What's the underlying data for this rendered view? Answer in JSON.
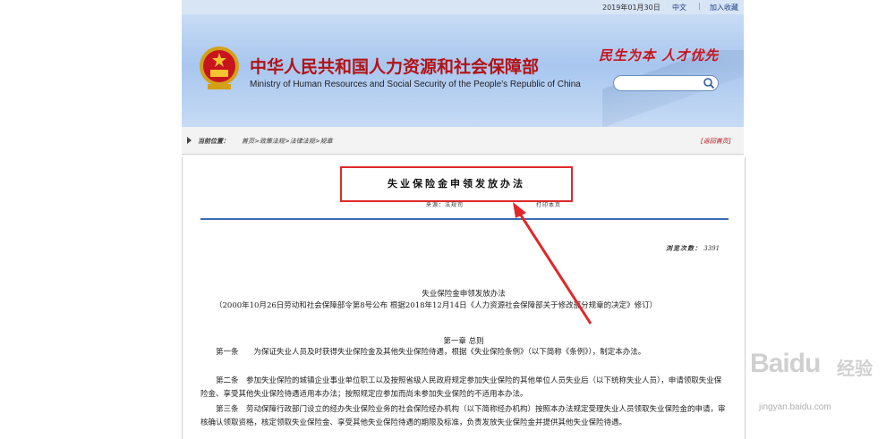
{
  "topbar": {
    "date": "2019年01月30日",
    "lang": "中文",
    "separator": "|",
    "favorite": "加入收藏"
  },
  "header": {
    "title_cn": "中华人民共和国人力资源和社会保障部",
    "title_en": "Ministry of Human Resources and Social Security of the People's Republic of China",
    "slogan": "民生为本  人才优先",
    "search_placeholder": "",
    "icons": {
      "emblem": "national-emblem",
      "search": "search-icon"
    }
  },
  "breadcrumb": {
    "label": "当前位置：",
    "path": "首页>政策法规>法律法规>规章",
    "back": "[返回首页]"
  },
  "article": {
    "heading": "失业保险金申领发放办法",
    "source": "来源：法规司",
    "print": "打印本页",
    "views_label": "浏览次数：",
    "views_count": "3391",
    "body_title": "失业保险金申领发放办法",
    "subtitle": "（2000年10月26日劳动和社会保障部令第8号公布  根据2018年12月14日《人力资源社会保障部关于修改部分规章的决定》修订）",
    "chapter": "第一章  总则",
    "paragraphs": [
      "　　第一条　　为保证失业人员及时获得失业保险金及其他失业保险待遇，根据《失业保险条例》（以下简称《条例》），制定本办法。",
      "　　第二条　参加失业保险的城镇企业事业单位职工以及按照省级人民政府规定参加失业保险的其他单位人员失业后（以下统称失业人员），申请领取失业保险金、享受其他失业保险待遇适用本办法；按照规定应参加而尚未参加失业保险的不适用本办法。",
      "　　第三条　劳动保障行政部门设立的经办失业保险业务的社会保险经办机构（以下简称经办机构）按照本办法规定受理失业人员领取失业保险金的申请，审核确认领取资格，核定领取失业保险金、享受其他失业保险待遇的期限及标准，负责发放失业保险金并提供其他失业保险待遇。"
    ]
  },
  "watermark": {
    "logo": "Baidu",
    "word": "经验",
    "url": "jingyan.baidu.com"
  },
  "colors": {
    "accent_red": "#b31315",
    "annotation_red": "#e0282a",
    "rule_blue": "#3a6bb5"
  }
}
